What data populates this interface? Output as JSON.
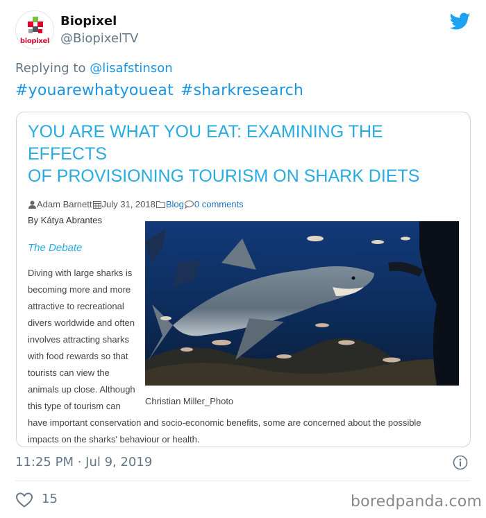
{
  "account": {
    "display_name": "Biopixel",
    "handle": "@BiopixelTV",
    "avatar_text": "biopixel"
  },
  "reply": {
    "prefix": "Replying to",
    "mention": "@lisafstinson"
  },
  "hashtags": [
    "#youarewhatyoueat",
    "#sharkresearch"
  ],
  "article": {
    "title_lines": [
      "YOU ARE WHAT YOU EAT: EXAMINING THE EFFECTS",
      "OF PROVISIONING TOURISM ON SHARK DIETS"
    ],
    "author": "Adam Barnett",
    "date": "July 31, 2018",
    "category": "Blog",
    "comments": "0 comments",
    "byline": "By Kátya Abrantes",
    "subheading": "The Debate",
    "body_narrow_lines": [
      "Diving with large sharks is",
      "becoming more and more",
      "attractive to recreational",
      "divers worldwide and often",
      "involves attracting sharks",
      "with food rewards so that",
      "tourists can view the",
      "animals up close. Although",
      "this type of tourism can"
    ],
    "body_wide_lines": [
      "have important conservation and socio-economic benefits, some are concerned about the possible",
      "impacts on the sharks' behaviour or health."
    ],
    "photo_caption": "Christian Miller_Photo"
  },
  "tweet_meta": {
    "timestamp": "11:25 PM · Jul 9, 2019",
    "likes": "15"
  },
  "watermark": "boredpanda.com",
  "colors": {
    "twitter_blue": "#1da1f2",
    "link_blue": "#1b95e0",
    "article_title": "#29abe2",
    "muted_gray": "#657786"
  },
  "icons": [
    "twitter-bird-icon",
    "info-icon",
    "heart-icon",
    "user-icon",
    "calendar-icon",
    "folder-icon",
    "comment-icon"
  ]
}
